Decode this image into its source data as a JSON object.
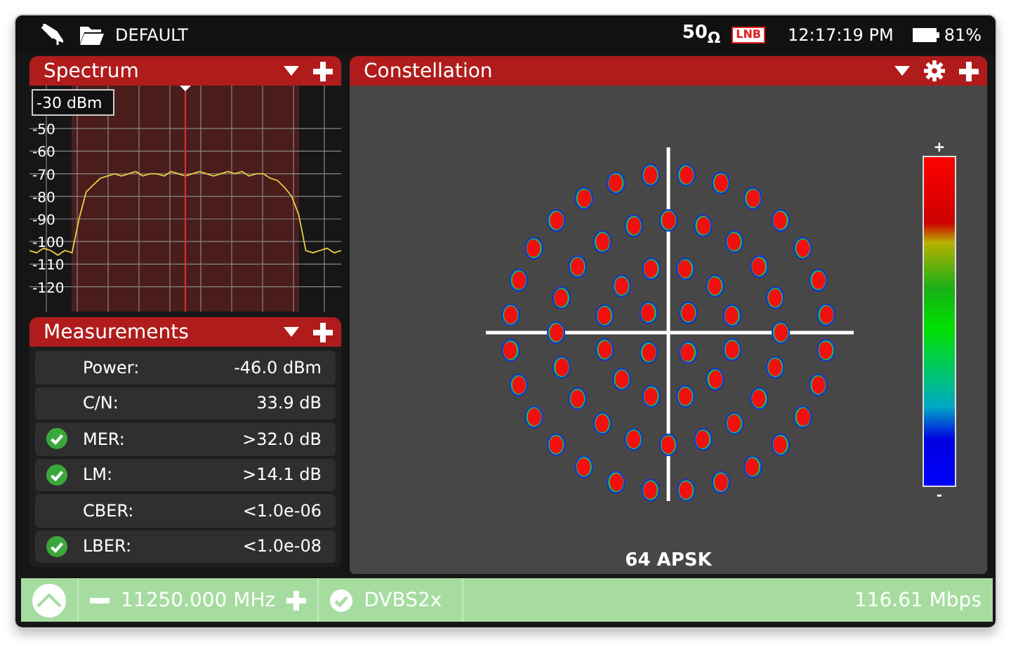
{
  "top_bar": {
    "profile": "DEFAULT",
    "impedance": "50$_{Ω}$",
    "lnb_badge": "LNB",
    "time": "12:17:19 PM",
    "battery": "81%"
  },
  "spectrum": {
    "title": "Spectrum",
    "ref_level": "-30 dBm",
    "center_marker": true,
    "chart_data": {
      "type": "line",
      "grid": true,
      "ylim": [
        -131,
        -31
      ],
      "yticks": [
        -50,
        -60,
        -70,
        -80,
        -90,
        -100,
        -110,
        -120
      ],
      "series": [
        {
          "color": "#e8d040",
          "values": [
            -104,
            -105,
            -103,
            -104,
            -106,
            -104,
            -105,
            -90,
            -78,
            -75,
            -72,
            -71,
            -70,
            -71,
            -70,
            -69,
            -71,
            -70,
            -70,
            -71,
            -69,
            -70,
            -71,
            -70,
            -69,
            -70,
            -71,
            -70,
            -69,
            -70,
            -69,
            -71,
            -70,
            -70,
            -72,
            -73,
            -76,
            -80,
            -88,
            -104,
            -105,
            -104,
            -103,
            -105,
            -104
          ]
        }
      ]
    }
  },
  "measurements": {
    "title": "Measurements",
    "rows": [
      {
        "label": "Power:",
        "value": "-46.0 dBm",
        "ok": false
      },
      {
        "label": "C/N:",
        "value": "33.9 dB",
        "ok": false
      },
      {
        "label": "MER:",
        "value": ">32.0 dB",
        "ok": true
      },
      {
        "label": "LM:",
        "value": ">14.1 dB",
        "ok": true
      },
      {
        "label": "CBER:",
        "value": "<1.0e-06",
        "ok": false
      },
      {
        "label": "LBER:",
        "value": "<1.0e-08",
        "ok": true
      }
    ]
  },
  "constellation": {
    "title": "Constellation",
    "modulation": "64 APSK",
    "scale_max": "+",
    "scale_min": "-"
  },
  "bottom_bar": {
    "locked": true,
    "frequency": "11250.000 MHz",
    "standard": "DVBS2x",
    "bitrate": "116.61 Mbps"
  }
}
